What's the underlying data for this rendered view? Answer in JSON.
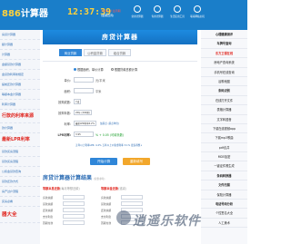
{
  "header": {
    "logo_prefix": "",
    "logo_num": "886",
    "logo_text": "计算器",
    "clock": "12:37:39",
    "date_line1": "7月25 人生周期",
    "date_line2": "(星期四周)",
    "items": [
      {
        "label": "常用计算器"
      },
      {
        "label": "专用计算器"
      },
      {
        "label": "生活实用工具"
      },
      {
        "label": "联系网站主机"
      }
    ]
  },
  "sidebar": {
    "items": [
      {
        "label": "房贷计算器",
        "kind": "normal"
      },
      {
        "label": "额计算器",
        "kind": "normal"
      },
      {
        "label": "计算器",
        "kind": "normal"
      },
      {
        "label": "金额贷款计算器",
        "kind": "normal"
      },
      {
        "label": "金贷款利率新规定",
        "kind": "normal"
      },
      {
        "label": "提前还款计算器",
        "kind": "normal"
      },
      {
        "label": "等额本金计算器",
        "kind": "normal"
      },
      {
        "label": "利率计算器",
        "kind": "normal"
      },
      {
        "label": "行款的利率来源",
        "kind": "big"
      },
      {
        "label": "款计算器",
        "kind": "normal"
      },
      {
        "label": "最新LPR利率",
        "kind": "big"
      },
      {
        "label": "贷款买房流程",
        "kind": "normal"
      },
      {
        "label": "贷款买房流程",
        "kind": "normal"
      },
      {
        "label": "公积金贷款查询",
        "kind": "normal"
      },
      {
        "label": "贷款还款方式",
        "kind": "normal"
      },
      {
        "label": "房产过户流程",
        "kind": "normal"
      },
      {
        "label": "买房必看",
        "kind": "normal"
      },
      {
        "label": "器大全",
        "kind": "big2"
      }
    ]
  },
  "main": {
    "banner": "房贷计算器",
    "tabs": [
      {
        "label": "商业贷款",
        "active": true
      },
      {
        "label": "公积金贷款",
        "active": false
      },
      {
        "label": "组合贷款",
        "active": false
      }
    ],
    "calc_mode": {
      "option1": "根据面积、单价计算",
      "option2": "根据贷款总额计算"
    },
    "rows": {
      "unit_price_label": "单价:",
      "unit_price_unit": "元/平米",
      "area_label": "面积:",
      "area_unit": "平米",
      "ratio_label": "按揭成数:",
      "ratio_value": "7成",
      "term_label": "按揭年数:",
      "term_value": "20年 (240期)",
      "rate_label": "利率:",
      "rate_select": "最新LPR利率4.2%",
      "rate_note": "加基点 (基点单位)",
      "lpr_label": "LPR利率:",
      "lpr_value": "3.95",
      "lpr_note": "% + 0.05 (可填负数)",
      "tip": "五年以上利率LPR: 4.2% 五年以上公积金利率 3.1% 更多调整↓"
    },
    "buttons": {
      "calc": "开始计算",
      "reset": "重新填写"
    },
    "result": {
      "title": "房贷计算器计算结果",
      "subtitle": "(仅供参考)",
      "col1_title": "等额本息还款",
      "col1_sub": "(每月等额还款)",
      "col2_title": "等额本金还款",
      "col2_sub": "(递减)",
      "lines": [
        "房款总额",
        "贷款总额",
        "还款总额",
        "支付利息",
        "首期付款",
        "贷款月数",
        "月均还款"
      ]
    }
  },
  "rside": {
    "items": [
      {
        "label": "心理健康测评",
        "style": "bold"
      },
      {
        "label": "车牌号查询",
        "style": "bold"
      },
      {
        "label": "东方卫视在线",
        "style": "bold"
      },
      {
        "label": "房地产查询系统",
        "style": "normal"
      },
      {
        "label": "手机号在线查询",
        "style": "normal"
      },
      {
        "label": "谷歌地图",
        "style": "normal"
      },
      {
        "label": "条码识别",
        "style": "bold"
      },
      {
        "label": "在线打开文件",
        "style": "normal"
      },
      {
        "label": "表格计算器",
        "style": "normal"
      },
      {
        "label": "文字转语音",
        "style": "normal"
      },
      {
        "label": "下载在线视频app",
        "style": "normal"
      },
      {
        "label": "下载mp3歌曲",
        "style": "normal"
      },
      {
        "label": "pdf合并",
        "style": "normal"
      },
      {
        "label": "MD5加密",
        "style": "normal"
      },
      {
        "label": "一键证件照生成",
        "style": "normal"
      },
      {
        "label": "条码转换器",
        "style": "bold"
      },
      {
        "label": "文件扫描",
        "style": "bold"
      },
      {
        "label": "保险计算器",
        "style": "normal"
      },
      {
        "label": "电话号码分析",
        "style": "bold"
      },
      {
        "label": "个性签名大全",
        "style": "normal"
      },
      {
        "label": "人工美术",
        "style": "normal"
      }
    ]
  },
  "watermark": "逍遥乐软件"
}
